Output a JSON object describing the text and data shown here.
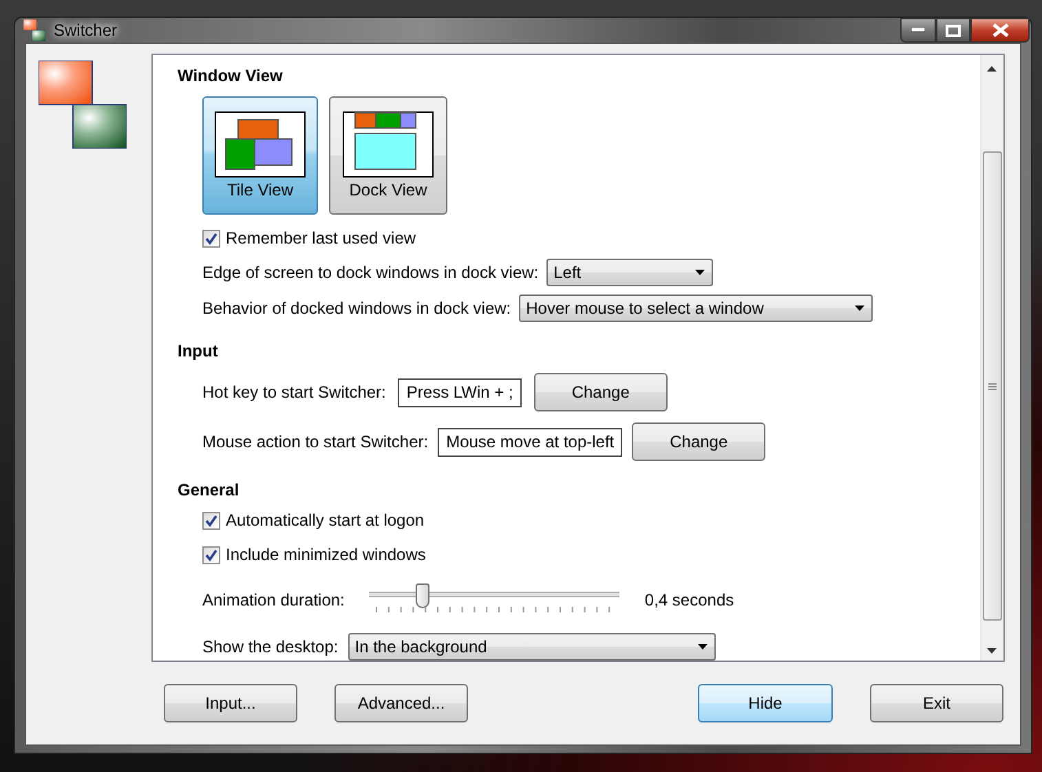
{
  "window": {
    "title": "Switcher"
  },
  "window_view": {
    "heading": "Window View",
    "views": [
      {
        "kind": "tile",
        "label": "Tile View",
        "selected": true
      },
      {
        "kind": "dock",
        "label": "Dock View",
        "selected": false
      }
    ],
    "remember": {
      "label": "Remember last used view",
      "checked": true
    },
    "dock_edge": {
      "label": "Edge of screen to dock windows in dock view:",
      "value": "Left"
    },
    "dock_behavior": {
      "label": "Behavior of docked windows in dock view:",
      "value": "Hover mouse to select a window"
    }
  },
  "input": {
    "heading": "Input",
    "hot_key": {
      "label": "Hot key to start Switcher:",
      "value": "Press LWin + ;",
      "button": "Change"
    },
    "mouse_action": {
      "label": "Mouse action to start Switcher:",
      "value": "Mouse move at top-left",
      "button": "Change"
    }
  },
  "general": {
    "heading": "General",
    "options": [
      {
        "label": "Automatically start at logon",
        "checked": true
      },
      {
        "label": "Include minimized windows",
        "checked": true
      }
    ],
    "animation": {
      "label": "Animation duration:",
      "level": 0.21,
      "reading": "0,4 seconds"
    },
    "desktop": {
      "label": "Show the desktop:",
      "value": "In the background"
    }
  },
  "left_buttons": [
    {
      "label": "Input...",
      "default": false
    },
    {
      "label": "Advanced...",
      "default": false
    }
  ],
  "right_buttons": [
    {
      "label": "Hide",
      "default": true
    },
    {
      "label": "Exit",
      "default": false
    }
  ]
}
